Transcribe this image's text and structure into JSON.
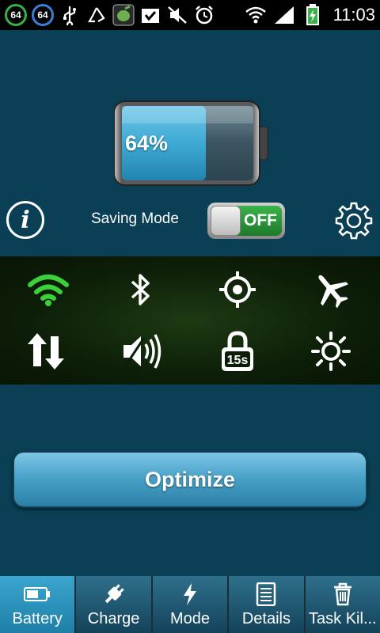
{
  "status_bar": {
    "badge1": "64",
    "badge2": "64",
    "icons": [
      "usb-icon",
      "recycle-icon",
      "app-icon",
      "checkbox-icon",
      "mute-icon",
      "alarm-icon",
      "wifi-icon",
      "signal-icon",
      "battery-charging-icon"
    ],
    "time": "11:03"
  },
  "battery": {
    "percent_label": "64%",
    "level": 0.64
  },
  "mode": {
    "saving_label": "Saving Mode",
    "toggle_state": "OFF"
  },
  "quick_toggles": [
    {
      "icon": "wifi-icon",
      "active": true
    },
    {
      "icon": "bluetooth-icon",
      "active": false
    },
    {
      "icon": "gps-icon",
      "active": false
    },
    {
      "icon": "airplane-icon",
      "active": false
    },
    {
      "icon": "data-sync-icon",
      "active": false
    },
    {
      "icon": "sound-icon",
      "active": false
    },
    {
      "icon": "screen-timeout-icon",
      "active": false,
      "label": "15s"
    },
    {
      "icon": "brightness-icon",
      "active": false
    }
  ],
  "optimize_label": "Optimize",
  "tabs": [
    {
      "label": "Battery",
      "icon": "battery-icon",
      "active": true
    },
    {
      "label": "Charge",
      "icon": "plug-icon",
      "active": false
    },
    {
      "label": "Mode",
      "icon": "lightning-icon",
      "active": false
    },
    {
      "label": "Details",
      "icon": "document-icon",
      "active": false
    },
    {
      "label": "Task Kil...",
      "icon": "trash-icon",
      "active": false
    }
  ],
  "colors": {
    "background": "#0a3f55",
    "accent_green": "#3ad13a",
    "battery_fill": "#3ea9d4"
  }
}
